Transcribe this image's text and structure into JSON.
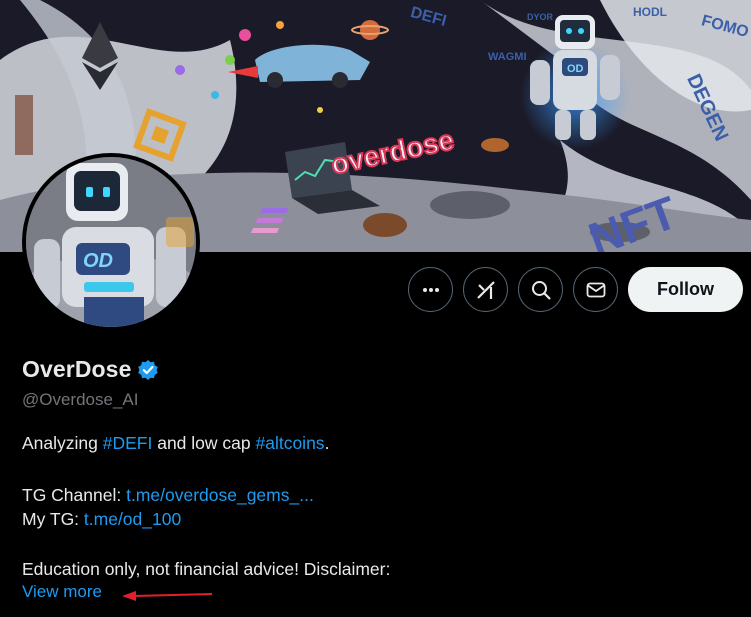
{
  "banner": {
    "stickers": [
      "DEFI",
      "DYOR",
      "HODL",
      "FOMO",
      "WAGMI",
      "DEGEN",
      "NFT",
      "overdose",
      "OD"
    ]
  },
  "profile": {
    "display_name": "OverDose",
    "handle": "@Overdose_AI",
    "verified": true,
    "bio_line1_prefix": "Analyzing ",
    "bio_line1_tag1": "#DEFI",
    "bio_line1_mid": " and low cap ",
    "bio_line1_tag2": "#altcoins",
    "bio_line1_suffix": ".",
    "tg_channel_label": "TG Channel: ",
    "tg_channel_link": "t.me/overdose_gems_...",
    "my_tg_label": "My TG: ",
    "my_tg_link": "t.me/od_100",
    "disclaimer": "Education only, not financial advice! Disclaimer:",
    "view_more": "View more"
  },
  "actions": {
    "more_icon": "more-icon",
    "grok_icon": "grok-icon",
    "search_icon": "search-icon",
    "message_icon": "message-icon",
    "follow_label": "Follow"
  },
  "colors": {
    "accent": "#1d9bf0",
    "background": "#000000",
    "text": "#e7e9ea",
    "muted": "#71767b",
    "annotation_arrow": "#e0202a"
  }
}
